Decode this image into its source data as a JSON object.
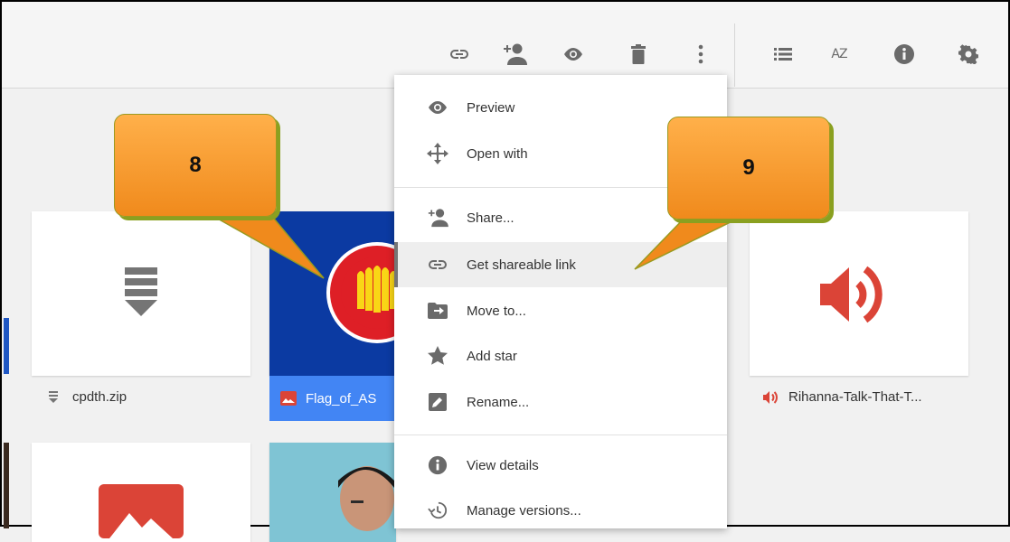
{
  "toolbar": {
    "icons": [
      "link-icon",
      "add-person-icon",
      "eye-icon",
      "trash-icon",
      "more-vert-icon",
      "list-view-icon",
      "sort-az-icon",
      "info-icon",
      "settings-icon"
    ],
    "sort_label": "AZ"
  },
  "files": [
    {
      "name": "cpdth.zip",
      "icon": "zip-icon"
    },
    {
      "name": "Flag_of_AS",
      "icon": "image-icon"
    },
    {
      "name": "Rihanna-Talk-That-T...",
      "icon": "audio-icon"
    }
  ],
  "menu": {
    "items": [
      {
        "label": "Preview",
        "icon": "eye-icon"
      },
      {
        "label": "Open with",
        "icon": "move-arrows-icon"
      },
      {
        "label": "Share...",
        "icon": "add-person-icon"
      },
      {
        "label": "Get shareable link",
        "icon": "link-icon",
        "active": true
      },
      {
        "label": "Move to...",
        "icon": "folder-move-icon"
      },
      {
        "label": "Add star",
        "icon": "star-icon"
      },
      {
        "label": "Rename...",
        "icon": "pencil-icon"
      },
      {
        "label": "View details",
        "icon": "info-icon"
      },
      {
        "label": "Manage versions...",
        "icon": "history-icon"
      }
    ]
  },
  "callouts": [
    {
      "number": "8"
    },
    {
      "number": "9"
    }
  ],
  "colors": {
    "accent_blue": "#4285f4",
    "audio_red": "#db4437",
    "callout_orange": "#f7941d",
    "icon_gray": "#6a6a6a"
  }
}
